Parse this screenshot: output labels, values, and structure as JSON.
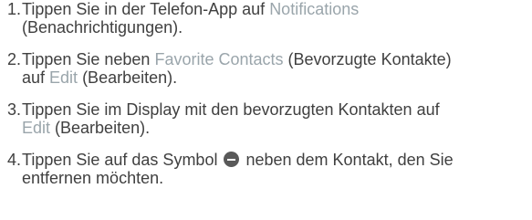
{
  "steps": [
    {
      "number": "1.",
      "line1": {
        "pre": "Tippen Sie in der Telefon-App auf ",
        "link": "Notifications"
      },
      "line2": {
        "text": "(Benachrichtigungen)."
      }
    },
    {
      "number": "2.",
      "line1": {
        "pre": "Tippen Sie neben ",
        "link": "Favorite Contacts",
        "post": " (Bevorzugte Kontakte)"
      },
      "line2": {
        "pre": "auf ",
        "link": "Edit",
        "post": " (Bearbeiten)."
      }
    },
    {
      "number": "3.",
      "line1": {
        "text": "Tippen Sie im Display mit den bevorzugten Kontakten auf"
      },
      "line2": {
        "link": "Edit",
        "post": " (Bearbeiten)."
      }
    },
    {
      "number": "4.",
      "line1": {
        "pre": "Tippen Sie auf das Symbol ",
        "icon": "minus-circle-icon",
        "post": " neben dem Kontakt, den Sie"
      },
      "line2": {
        "text": "entfernen möchten."
      }
    }
  ],
  "colors": {
    "text": "#404040",
    "link": "#9aa5ab",
    "icon": "#595959"
  }
}
